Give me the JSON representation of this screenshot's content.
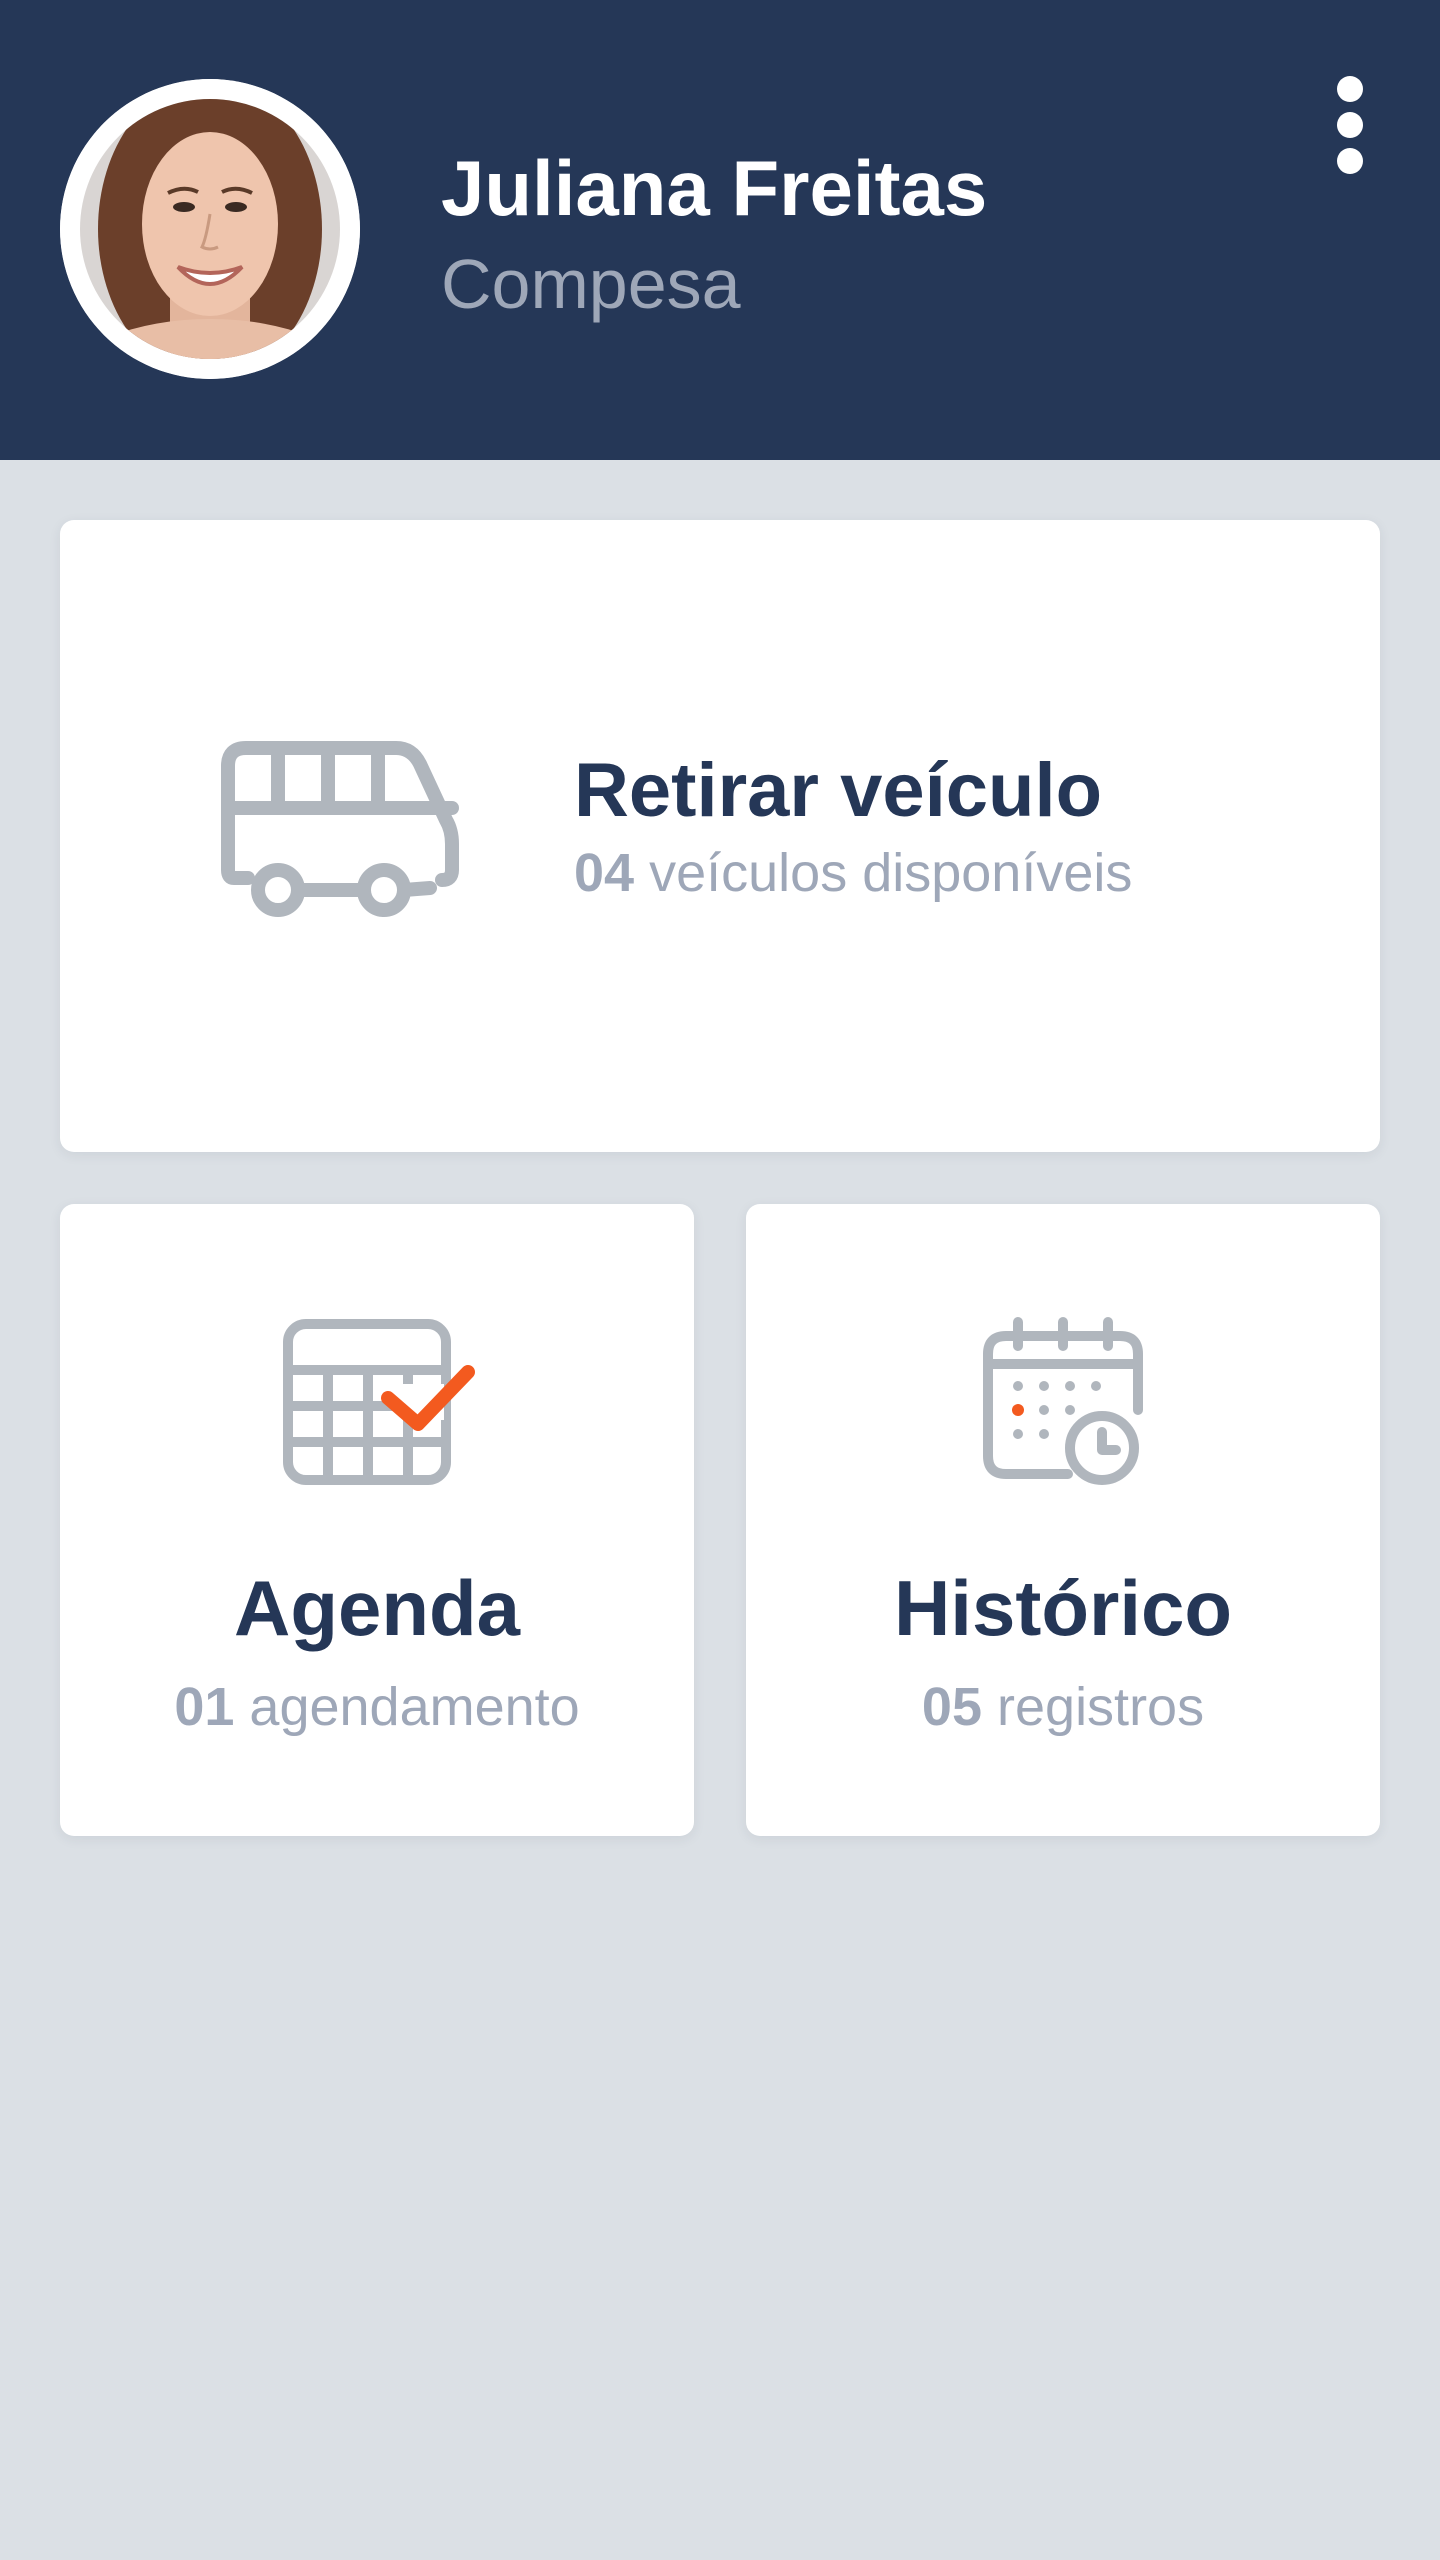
{
  "header": {
    "user_name": "Juliana Freitas",
    "organization": "Compesa",
    "background_color": "#253757",
    "menu_icon": "more-vertical-icon"
  },
  "cards": {
    "vehicle": {
      "icon": "bus-icon",
      "title": "Retirar veículo",
      "count": "04",
      "subtitle": "veículos disponíveis"
    },
    "agenda": {
      "icon": "calendar-check-icon",
      "title": "Agenda",
      "count": "01",
      "subtitle": "agendamento"
    },
    "history": {
      "icon": "calendar-clock-icon",
      "title": "Histórico",
      "count": "05",
      "subtitle": "registros"
    }
  },
  "colors": {
    "primary": "#253757",
    "muted_text": "#9ea7b8",
    "icon_gray": "#b0b6bd",
    "accent_orange": "#f35a1f",
    "page_background": "#dbe0e5"
  }
}
